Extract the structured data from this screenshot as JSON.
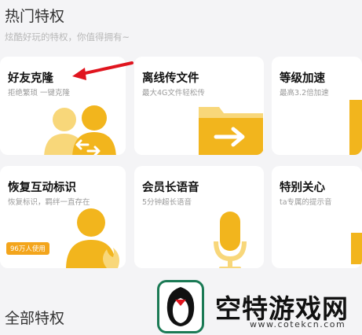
{
  "header": {
    "title": "热门特权",
    "subtitle": "炫酷好玩的特权，你值得拥有~"
  },
  "cards": [
    {
      "title": "好友克隆",
      "desc": "拒绝繁琐 一键克隆"
    },
    {
      "title": "离线传文件",
      "desc": "最大4G文件轻松传"
    },
    {
      "title": "等级加速",
      "desc": "最高3.2倍加速"
    },
    {
      "title": "恢复互动标识",
      "desc": "恢复标识，羁绊一直存在",
      "badge": "96万人使用"
    },
    {
      "title": "会员长语音",
      "desc": "5分钟超长语音"
    },
    {
      "title": "特别关心",
      "desc": "ta专属的提示音"
    }
  ],
  "section_all": "全部特权",
  "watermark": {
    "text": "空特游戏网",
    "url": "www.cotekcn.com"
  },
  "colors": {
    "accent": "#f2b51d",
    "accent_light": "#f8d77a",
    "badge_bg": "#f3a51c",
    "arrow": "#e0141e"
  }
}
